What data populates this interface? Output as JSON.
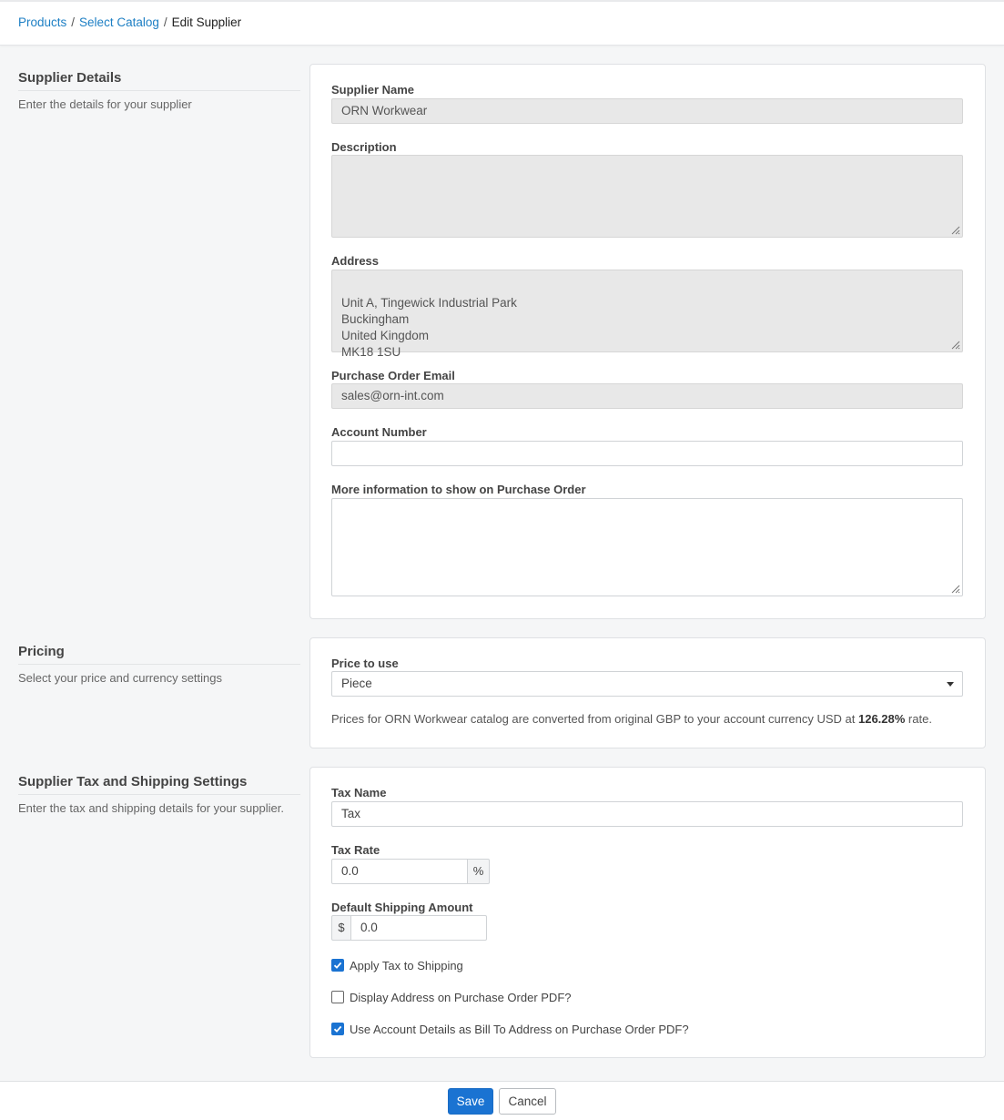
{
  "breadcrumb": {
    "items": [
      "Products",
      "Select Catalog"
    ],
    "separator": "/",
    "current": "Edit Supplier"
  },
  "supplier_details": {
    "title": "Supplier Details",
    "description": "Enter the details for your supplier",
    "supplier_name_label": "Supplier Name",
    "supplier_name_value": "ORN Workwear",
    "description_label": "Description",
    "description_value": "",
    "address_label": "Address",
    "address_value": "Unit A, Tingewick Industrial Park\nBuckingham\nUnited Kingdom\nMK18 1SU",
    "po_email_label": "Purchase Order Email",
    "po_email_value": "sales@orn-int.com",
    "account_number_label": "Account Number",
    "account_number_value": "",
    "more_info_label": "More information to show on Purchase Order",
    "more_info_value": ""
  },
  "pricing": {
    "title": "Pricing",
    "description": "Select your price and currency settings",
    "price_label": "Price to use",
    "price_value": "Piece",
    "note_prefix": "Prices for ORN Workwear catalog are converted from original GBP to your account currency USD at ",
    "note_rate": "126.28%",
    "note_suffix": " rate."
  },
  "tax_shipping": {
    "title": "Supplier Tax and Shipping Settings",
    "description": "Enter the tax and shipping details for your supplier.",
    "tax_name_label": "Tax Name",
    "tax_name_value": "Tax",
    "tax_rate_label": "Tax Rate",
    "tax_rate_value": "0.0",
    "tax_rate_suffix": "%",
    "shipping_label": "Default Shipping Amount",
    "shipping_prefix": "$",
    "shipping_value": "0.0",
    "checkboxes": [
      {
        "label": "Apply Tax to Shipping",
        "checked": true
      },
      {
        "label": "Display Address on Purchase Order PDF?",
        "checked": false
      },
      {
        "label": "Use Account Details as Bill To Address on Purchase Order PDF?",
        "checked": true
      }
    ]
  },
  "footer": {
    "save_label": "Save",
    "cancel_label": "Cancel"
  },
  "colors": {
    "link": "#1d7fc4",
    "primary": "#1a73d2",
    "readonly_bg": "#e8e8e8"
  }
}
